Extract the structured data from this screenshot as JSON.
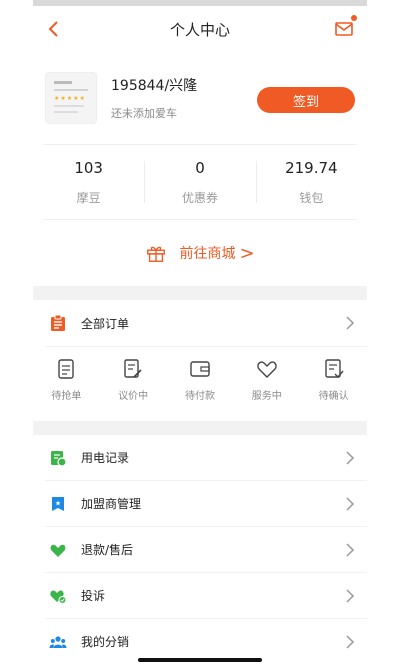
{
  "header": {
    "title": "个人中心"
  },
  "profile": {
    "name": "195844/兴隆",
    "subtitle": "还未添加爱车",
    "checkin_label": "签到"
  },
  "stats": [
    {
      "value": "103",
      "label": "摩豆"
    },
    {
      "value": "0",
      "label": "优惠券"
    },
    {
      "value": "219.74",
      "label": "钱包"
    }
  ],
  "mall": {
    "label": "前往商城",
    "arrow": ">"
  },
  "orders": {
    "title": "全部订单",
    "items": [
      {
        "label": "待抢单",
        "icon": "clipboard-icon"
      },
      {
        "label": "议价中",
        "icon": "document-edit-icon"
      },
      {
        "label": "待付款",
        "icon": "wallet-icon"
      },
      {
        "label": "服务中",
        "icon": "heart-icon"
      },
      {
        "label": "待确认",
        "icon": "document-check-icon"
      }
    ]
  },
  "menu": [
    {
      "label": "用电记录",
      "icon": "power-record-icon",
      "color": "#3bb54a"
    },
    {
      "label": "加盟商管理",
      "icon": "star-badge-icon",
      "color": "#1e88e5"
    },
    {
      "label": "退款/售后",
      "icon": "heart-icon",
      "color": "#3bb54a"
    },
    {
      "label": "投诉",
      "icon": "heart-check-icon",
      "color": "#3bb54a"
    },
    {
      "label": "我的分销",
      "icon": "group-icon",
      "color": "#1e88e5"
    }
  ],
  "colors": {
    "accent": "#f05a24"
  }
}
